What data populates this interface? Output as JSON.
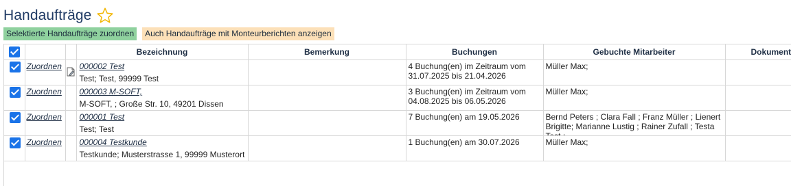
{
  "header": {
    "title": "Handaufträge"
  },
  "toolbar": {
    "assign_selected_label": "Selektierte Handaufträge zuordnen",
    "show_with_reports_label": "Auch Handaufträge mit Monteurberichten anzeigen"
  },
  "table": {
    "columns": {
      "bezeichnung": "Bezeichnung",
      "bemerkung": "Bemerkung",
      "buchungen": "Buchungen",
      "mitarbeiter": "Gebuchte Mitarbeiter",
      "dokumente": "Dokumente"
    },
    "rows": [
      {
        "action": "Zuordnen",
        "title": "000002 Test",
        "subtitle": "Test; Test, 99999 Test",
        "bemerkung": "",
        "buchungen": "4 Buchung(en) im Zeitraum vom 31.07.2025 bis 21.04.2026",
        "mitarbeiter": "Müller Max;",
        "dokumente": ""
      },
      {
        "action": "Zuordnen",
        "title": "000003 M-SOFT,",
        "subtitle": "M-SOFT, ; Große Str. 10, 49201 Dissen",
        "bemerkung": "",
        "buchungen": "3 Buchung(en) im Zeitraum vom 04.08.2025 bis 06.05.2026",
        "mitarbeiter": "Müller Max;",
        "dokumente": ""
      },
      {
        "action": "Zuordnen",
        "title": "000001 Test",
        "subtitle": "Test; Test",
        "bemerkung": "",
        "buchungen": "7 Buchung(en) am 19.05.2026",
        "mitarbeiter": "Bernd Peters ; Clara Fall ; Franz Müller ; Lienert Brigitte; Marianne Lustig ; Rainer Zufall ; Testa Test ;",
        "dokumente": ""
      },
      {
        "action": "Zuordnen",
        "title": "000004 Testkunde",
        "subtitle": "Testkunde; Musterstrasse 1, 99999 Musterort",
        "bemerkung": "",
        "buchungen": "1 Buchung(en) am 30.07.2026",
        "mitarbeiter": "Müller Max;",
        "dokumente": ""
      }
    ]
  }
}
